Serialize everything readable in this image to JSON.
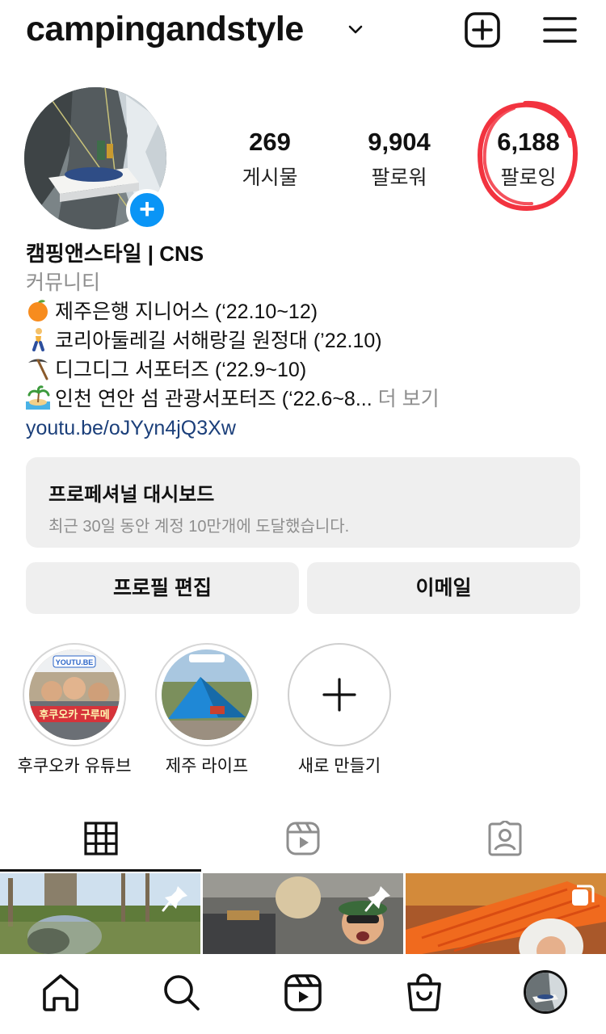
{
  "header": {
    "username": "campingandstyle",
    "icons": [
      "chevron-down-icon",
      "new-post-icon",
      "menu-icon"
    ]
  },
  "profile": {
    "stats": [
      {
        "value": "269",
        "label": "게시물"
      },
      {
        "value": "9,904",
        "label": "팔로워"
      },
      {
        "value": "6,188",
        "label": "팔로잉"
      }
    ],
    "annotation_color": "#f2333f"
  },
  "bio": {
    "name": "캠핑앤스타일 | CNS",
    "category": "커뮤니티",
    "lines": [
      {
        "emoji": "orange",
        "text": "제주은행 지니어스 (‘22.10~12)"
      },
      {
        "emoji": "walking-person",
        "text": "코리아둘레길 서해랑길 원정대 (’22.10)"
      },
      {
        "emoji": "pickaxe",
        "text": "디그디그 서포터즈 (‘22.9~10)"
      },
      {
        "emoji": "island",
        "text": "인천 연안 섬 관광서포터즈 (‘22.6~8..."
      }
    ],
    "more": "더 보기",
    "link": "youtu.be/oJYyn4jQ3Xw"
  },
  "dashboard": {
    "title": "프로페셔널 대시보드",
    "subtitle": "최근 30일 동안 계정 10만개에 도달했습니다."
  },
  "buttons": {
    "edit_profile": "프로필 편집",
    "email": "이메일"
  },
  "highlights": [
    {
      "label": "후쿠오카 유튜브",
      "overlay_text": "후쿠오카 구루메",
      "badge": "YOUTU.BE"
    },
    {
      "label": "제주 라이프"
    },
    {
      "label": "새로 만들기"
    }
  ],
  "tabs": [
    "grid-icon",
    "reels-icon",
    "tagged-icon"
  ],
  "bottom_nav": [
    "home-icon",
    "search-icon",
    "reels-icon",
    "shop-icon",
    "profile-avatar"
  ],
  "colors": {
    "accent_blue": "#0a95f6",
    "link": "#1b3f7a",
    "muted": "#8e8e8e",
    "button_bg": "#efefef"
  }
}
